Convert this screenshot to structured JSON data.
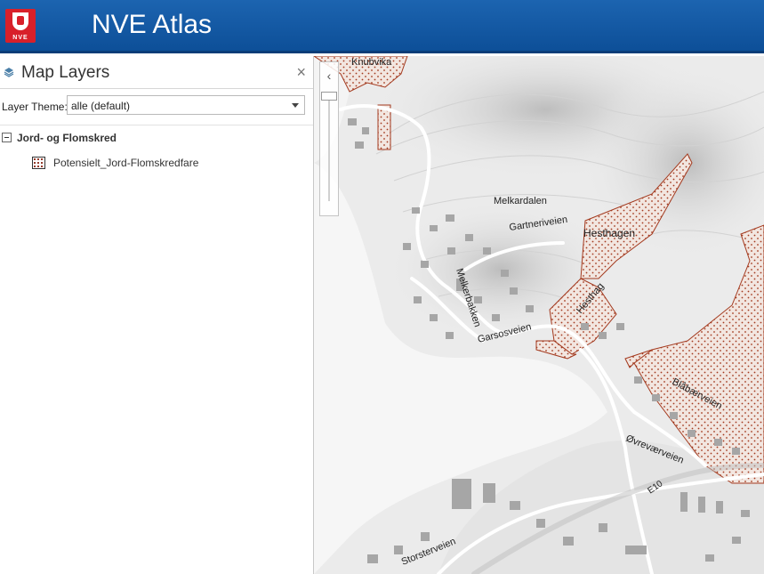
{
  "header": {
    "logo_text": "NVE",
    "title": "NVE Atlas",
    "color": "#0f55a0"
  },
  "panel": {
    "title": "Map Layers",
    "close_symbol": "×",
    "icon": "layers-icon",
    "theme_label": "Layer Theme:",
    "theme_value": "alle (default)",
    "groups": [
      {
        "label": "Jord- og Flomskred",
        "toggle": "−",
        "layers": [
          {
            "label": "Potensielt_Jord-Flomskredfare",
            "swatch": "dotted-hatch"
          }
        ]
      }
    ]
  },
  "map": {
    "labels": [
      "Knubvika",
      "Melkardalen",
      "Gartneriveien",
      "Hesthagen",
      "Melkerbakken",
      "Garsosveien",
      "Hesthag",
      "Blåbærveien",
      "Øvreværveien",
      "E10",
      "Storsterveien"
    ],
    "hazard_color": "#a33a1f",
    "zoom_arrow": "‹"
  }
}
